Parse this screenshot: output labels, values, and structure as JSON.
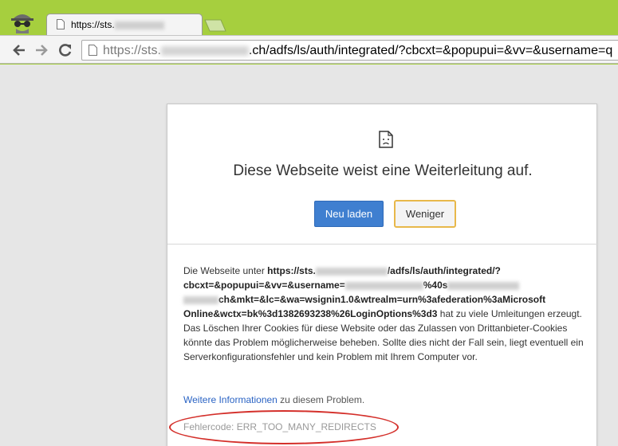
{
  "browser": {
    "tab_title_prefix": "https://sts.",
    "url_prefix": "https://sts.",
    "url_suffix": ".ch/adfs/ls/auth/integrated/?cbcxt=&popupui=&vv=&username=q"
  },
  "error_page": {
    "heading": "Diese Webseite weist eine Weiterleitung auf.",
    "reload_label": "Neu laden",
    "less_label": "Weniger",
    "detail_intro": "Die Webseite unter ",
    "detail_url_start": "https://sts.",
    "detail_url_mid": "/adfs/ls/auth/integrated/?",
    "detail_url_line2": "cbcxt=&popupui=&vv=&username=",
    "detail_url_line2_b": "%40s",
    "detail_url_line3": "ch&mkt=&lc=&wa=wsignin1.0&wtrealm=urn%3afederation%3aMicrosoft",
    "detail_url_line4": "Online&wctx=bk%3d1382693238%26LoginOptions%3d3",
    "detail_rest": " hat zu viele Umleitungen erzeugt. Das Löschen Ihrer Cookies für diese Website oder das Zulassen von Drittanbieter-Cookies könnte das Problem möglicherweise beheben. Sollte dies nicht der Fall sein, liegt eventuell ein Serverkonfigurationsfehler und kein Problem mit Ihrem Computer vor.",
    "more_link": "Weitere Informationen",
    "more_text": " zu diesem Problem.",
    "error_code": "Fehlercode: ERR_TOO_MANY_REDIRECTS"
  },
  "colors": {
    "frame": "#a6cf3e",
    "reload_button": "#3f7fd0",
    "highlight_circle": "#d4302b",
    "link": "#2a63c4"
  },
  "icons": {
    "incognito": "incognito-icon",
    "tab_favicon": "page-icon",
    "back": "back-arrow-icon",
    "forward": "forward-arrow-icon",
    "reload": "reload-icon",
    "error": "sad-page-icon"
  }
}
